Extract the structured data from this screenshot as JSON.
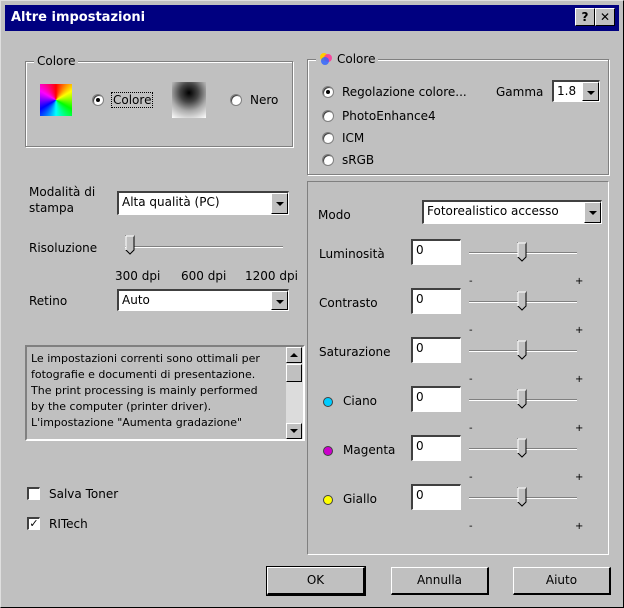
{
  "window": {
    "title": "Altre impostazioni",
    "help_glyph": "?",
    "close_glyph": "✕"
  },
  "color_group": {
    "legend": "Colore",
    "options": [
      {
        "label": "Colore",
        "selected": true
      },
      {
        "label": "Nero",
        "selected": false
      }
    ]
  },
  "print_mode": {
    "label": "Modalità di stampa",
    "label_line1": "Modalità di",
    "label_line2": "stampa",
    "value": "Alta qualità (PC)"
  },
  "resolution": {
    "label": "Risoluzione",
    "ticks": [
      "300 dpi",
      "600 dpi",
      "1200 dpi"
    ],
    "selected_index": 0
  },
  "halftone": {
    "label": "Retino",
    "value": "Auto"
  },
  "description": {
    "lines": [
      "Le impostazioni correnti sono ottimali per",
      "fotografie e documenti di presentazione.",
      "The print processing is mainly performed",
      "by the computer (printer driver).",
      "L'impostazione \"Aumenta gradazione\""
    ]
  },
  "options": {
    "save_toner": {
      "label": "Salva Toner",
      "checked": false
    },
    "ritech": {
      "label": "RITech",
      "checked": true
    }
  },
  "color_panel": {
    "legend": "Colore",
    "modes": [
      {
        "label": "Regolazione colore...",
        "selected": true
      },
      {
        "label": "PhotoEnhance4",
        "selected": false
      },
      {
        "label": "ICM",
        "selected": false
      },
      {
        "label": "sRGB",
        "selected": false
      }
    ],
    "gamma": {
      "label": "Gamma",
      "value": "1.8"
    }
  },
  "adjust_panel": {
    "mode_label": "Modo",
    "mode_value": "Fotorealistico accesso",
    "tick_minus": "-",
    "tick_plus": "+",
    "sliders": [
      {
        "label": "Luminosità",
        "value": "0",
        "swatch": null
      },
      {
        "label": "Contrasto",
        "value": "0",
        "swatch": null
      },
      {
        "label": "Saturazione",
        "value": "0",
        "swatch": null
      },
      {
        "label": "Ciano",
        "value": "0",
        "swatch": "#00ccff"
      },
      {
        "label": "Magenta",
        "value": "0",
        "swatch": "#cc00cc"
      },
      {
        "label": "Giallo",
        "value": "0",
        "swatch": "#ffff00"
      }
    ]
  },
  "buttons": {
    "ok": "OK",
    "cancel": "Annulla",
    "help": "Aiuto"
  },
  "colors": {
    "titlebar": "#000080",
    "face": "#c0c0c0"
  }
}
